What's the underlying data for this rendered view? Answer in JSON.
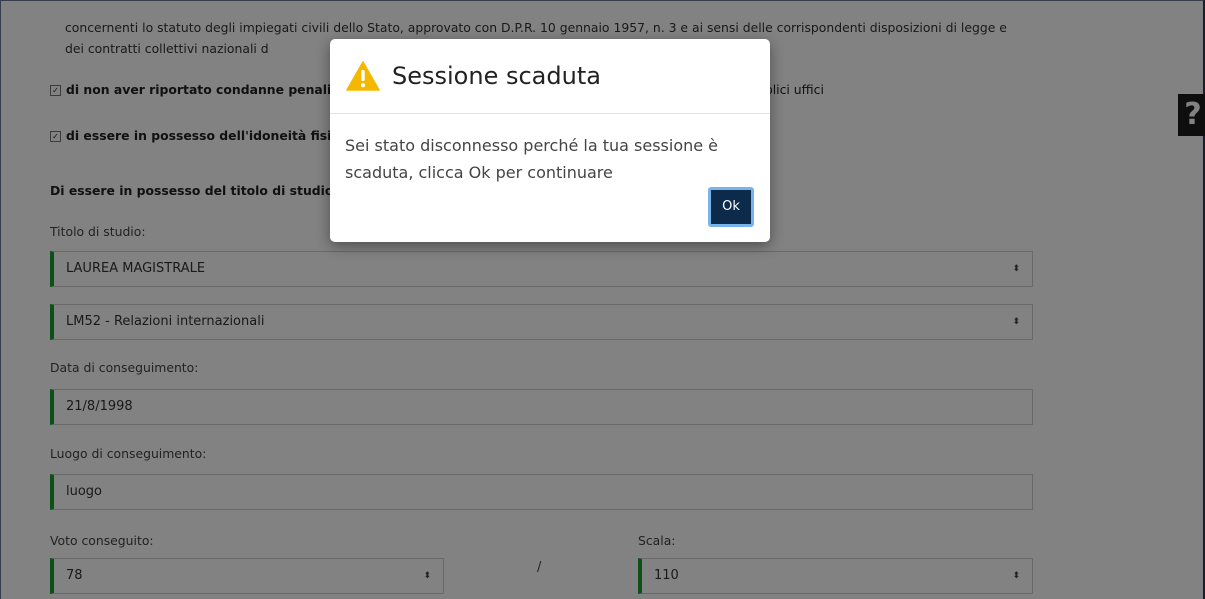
{
  "form": {
    "paragraph": "concernenti lo statuto degli impiegati civili dello Stato, approvato con D.P.R. 10 gennaio 1957, n. 3 e ai sensi delle corrispondenti disposizioni di legge e dei contratti collettivi nazionali d",
    "check1": {
      "bold": "di non aver riportato condanne penali",
      "rest": ",",
      "tail": "bblici uffici"
    },
    "check2": {
      "bold": "di essere in possesso dell'idoneità fisi"
    },
    "section_heading": "Di essere in possesso del titolo di studio",
    "titolo_label": "Titolo di studio:",
    "titolo_value": "LAUREA MAGISTRALE",
    "classe_value": "LM52 - Relazioni internazionali",
    "data_label": "Data di conseguimento:",
    "data_value": "21/8/1998",
    "luogo_label": "Luogo di conseguimento:",
    "luogo_value": "luogo",
    "voto_label": "Voto conseguito:",
    "voto_value": "78",
    "scala_label": "Scala:",
    "scala_value": "110",
    "slash": "/",
    "select_arrow": "⬍"
  },
  "help_badge": "?",
  "modal": {
    "title": "Sessione scaduta",
    "icon": "warning-triangle-icon",
    "icon_color": "#f5b800",
    "body": "Sei stato disconnesso perché la tua sessione è scaduta, clicca Ok per continuare",
    "ok_label": "Ok"
  },
  "colors": {
    "accent_green": "#18a033",
    "ok_button": "#0c2a4a",
    "ok_border": "#78b4ea"
  }
}
